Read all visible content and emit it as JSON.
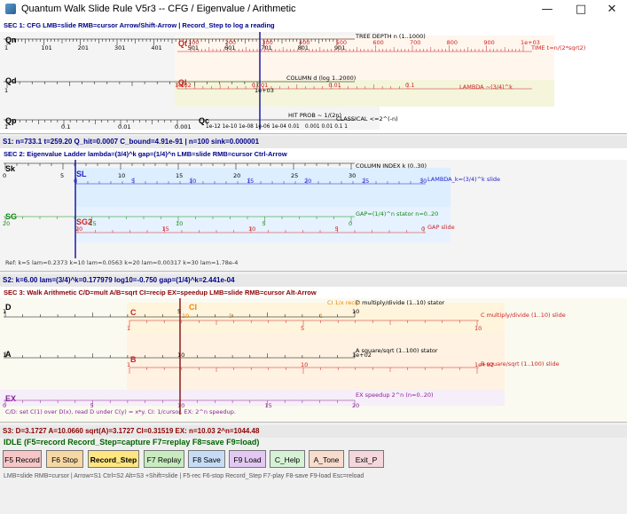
{
  "window": {
    "title": "Quantum Walk Slide Rule V5r3  --  CFG / Eigenvalue / Arithmetic"
  },
  "sec1": {
    "header": "SEC 1: CFG  LMB=slide  RMB=cursor  Arrow/Shift-Arrow  | Record_Step to log a reading",
    "qn": "Qn",
    "qd": "Qd",
    "qp": "Qp",
    "qt": "Qt",
    "ql": "Ql",
    "qc": "Qc",
    "qn_ticks": [
      "1",
      "101",
      "201",
      "301",
      "401",
      "501",
      "601",
      "701",
      "801",
      "901"
    ],
    "qt_ticks": [
      "100",
      "200",
      "300",
      "400",
      "500",
      "600",
      "700",
      "800",
      "900",
      "1e+03"
    ],
    "qd_ticks": [
      "1",
      "1e+03"
    ],
    "ql_ticks": [
      "1e-02",
      "0.001",
      "0.01",
      "0.1"
    ],
    "qp_ticks": [
      "1",
      "0.1",
      "0.01",
      "0.001"
    ],
    "tree_depth": "TREE DEPTH n  (1..1000)",
    "time_label": "TIME t=n/(2*sqrt2)",
    "column_d": "COLUMN d  (log 1..2000)",
    "lambda_label": "LAMBDA ~(3/4)^k",
    "hit_prob": "HIT PROB ~ 1/(2n)",
    "classical": "CLASSICAL  <=2^(-n)",
    "qc_ticks": "1e-12 1e-10 1e-08 1e-06 1e-04 0.01",
    "qp_tail_ticks": "0.001 0.01  0.1 1"
  },
  "status1": "S1: n=733.1  t=259.20  Q_hit=0.0007  C_bound=4.91e-91  | n=100 sink=0.000001",
  "sec2": {
    "header": "SEC 2: Eigenvalue Ladder  lambda=(3/4)^k  gap=(1/4)^n  LMB=slide  RMB=cursor  Ctrl-Arrow",
    "sk": "Sk",
    "sg": "SG",
    "sl": "SL",
    "sg2": "SG2",
    "sk_ticks": [
      "0",
      "5",
      "10",
      "15",
      "20",
      "25",
      "30"
    ],
    "sl_ticks": [
      "0",
      "5",
      "10",
      "15",
      "20",
      "25",
      "30"
    ],
    "sg_ticks": [
      "20",
      "15",
      "10",
      "5",
      "0"
    ],
    "sg2_ticks": [
      "20",
      "15",
      "10",
      "5",
      "0"
    ],
    "column_index": "COLUMN INDEX k  (0..30)",
    "lambda_slide": "LAMBDA_k=(3/4)^k  slide",
    "gap_stator": "GAP=(1/4)^n stator n=0..20",
    "gap_slide": "GAP slide",
    "ref": "Ref: k=5 lam=0.2373  k=10 lam=0.0563  k=20 lam=0.00317  k=30 lam=1.78e-4"
  },
  "status2": "S2: k=6.00  lam=(3/4)^k=0.177979  log10=-0.750  gap=(1/4)^k=2.441e-04",
  "sec3": {
    "header": "SEC 3: Walk Arithmetic  C/D=mult  A/B=sqrt  CI=recip  EX=speedup  LMB=slide  RMB=cursor  Alt-Arrow",
    "d": "D",
    "c": "C",
    "ci": "CI",
    "a": "A",
    "b": "B",
    "ex": "EX",
    "d_ticks": [
      "1",
      "5",
      "10"
    ],
    "c_ticks": [
      "1",
      "5",
      "10"
    ],
    "ci_ticks": [
      "10",
      "5",
      "1"
    ],
    "a_ticks": [
      "1",
      "10",
      "1e+02"
    ],
    "b_ticks": [
      "1",
      "10",
      "1e+02"
    ],
    "ex_ticks": [
      "0",
      "5",
      "10",
      "15",
      "20"
    ],
    "d_stator": "D multiply/divide (1..10) stator",
    "ci_recip": "CI 1/x recip",
    "c_slide": "C multiply/divide (1..10) slide",
    "a_stator": "A square/sqrt (1..100) stator",
    "b_slide": "B square/sqrt (1..100) slide",
    "ex_stator": "EX speedup 2^n (n=0..20)",
    "hint": "C/D: set C(1) over D(x), read D under C(y) = x*y.  CI: 1/cursor.  EX: 2^n speedup."
  },
  "status3": "S3: D=3.1727  A=10.0660  sqrt(A)=3.1727  CI=0.31519  EX: n=10.03  2^n=1044.48",
  "idle": "IDLE  (F5=record  Record_Step=capture  F7=replay  F8=save  F9=load)",
  "buttons": [
    {
      "label": "F5 Record",
      "color": "#f7c6c6"
    },
    {
      "label": "F6 Stop",
      "color": "#f6d8a4"
    },
    {
      "label": "Record_Step",
      "color": "#ffe680"
    },
    {
      "label": "F7 Replay",
      "color": "#c8ecc0"
    },
    {
      "label": "F8 Save",
      "color": "#c6dcf6"
    },
    {
      "label": "F9 Load",
      "color": "#e2c8f2"
    },
    {
      "label": "C_Help",
      "color": "#d6f2d6"
    },
    {
      "label": "A_Tone",
      "color": "#f8dccc"
    },
    {
      "label": "Exit_P",
      "color": "#f4d6dc"
    }
  ],
  "footer": "LMB=slide  RMB=cursor  | Arrow=S1  Ctrl=S2  Alt=S3  +Shift=slide  | F5-rec F6-stop Record_Step F7-play F8-save F9-load  Esc=reload",
  "colors": {
    "cursor1": "#1a1aa8",
    "cursor2": "#1a1aa8",
    "cursor3": "#8b1a1a",
    "header": "#00008b"
  }
}
